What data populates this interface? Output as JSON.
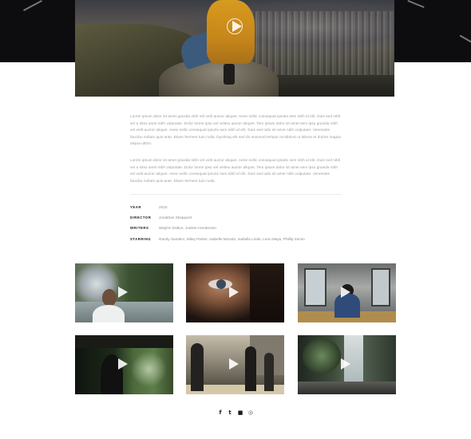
{
  "description": {
    "paragraph_1": "Lorem ipsum dolor sit amet gravida nibh vel velit auctor aliquet. Aene sollic consequat ipsutis sem nibh id elit. Duis sed nibh vel a sitsu amet nibh vulputate. Dolor lorem ipsu vel velitsu auctor aliquet. Tem ipsum dolor sit amet sem ipsu gravida nibh vel velit auctor aliquet. Aene sollic consequat ipsutis sem nibh id elit. Duis sed odio sit amet nibh vulputate. Venenatis faucibu nullam quis ante. Etiam ferment tum nulla. Dynilong elit sed do eiusmod tempor incididunt ut labore et dolore magna aliqua ultrim.",
    "paragraph_2": "Lorem ipsum dolor sit amet gravida nibh vel velit auctor aliquet. Aene sollic consequat ipsutis sem nibh id elit. Duis sed nibh vel a sitsu amet nibh vulputate. Dolor lorem ipsu vel velitsu auctor aliquet. Tem ipsum dolor sit amet sem ipsu gravida nibh vel velit auctor aliquet. Aene sollic consequat ipsutis sem nibh id elit. Duis sed odio sit amet nibh vulputate. Venenatis faucibu nullam quis ante. Etiam ferment tum nulla."
  },
  "info": [
    {
      "label": "YEAR",
      "value": "2015"
    },
    {
      "label": "DIRECTOR",
      "value": "Jonathan Sheppard"
    },
    {
      "label": "WRITERS",
      "value": "Waylon Dalton, Justine Henderson"
    },
    {
      "label": "STARRING",
      "value": "Randy Sanders, Miley Parker, Isabelle McIndo, Isabella Linde, Leon Mays, Phillip Simon"
    }
  ],
  "gallery": [
    {
      "id": "thumb-1",
      "icon": "play-icon"
    },
    {
      "id": "thumb-2",
      "icon": "play-icon"
    },
    {
      "id": "thumb-3",
      "icon": "play-icon"
    },
    {
      "id": "thumb-4",
      "icon": "play-icon"
    },
    {
      "id": "thumb-5",
      "icon": "play-icon"
    },
    {
      "id": "thumb-6",
      "icon": "play-icon"
    }
  ],
  "social": {
    "facebook": "f",
    "twitter": "t",
    "flickr": "■",
    "instagram": "◎"
  },
  "colors": {
    "hero_background": "#0d0d0f",
    "accent_coat": "#d79b1f",
    "text_muted": "#9a9a9a",
    "label_dark": "#222222"
  }
}
